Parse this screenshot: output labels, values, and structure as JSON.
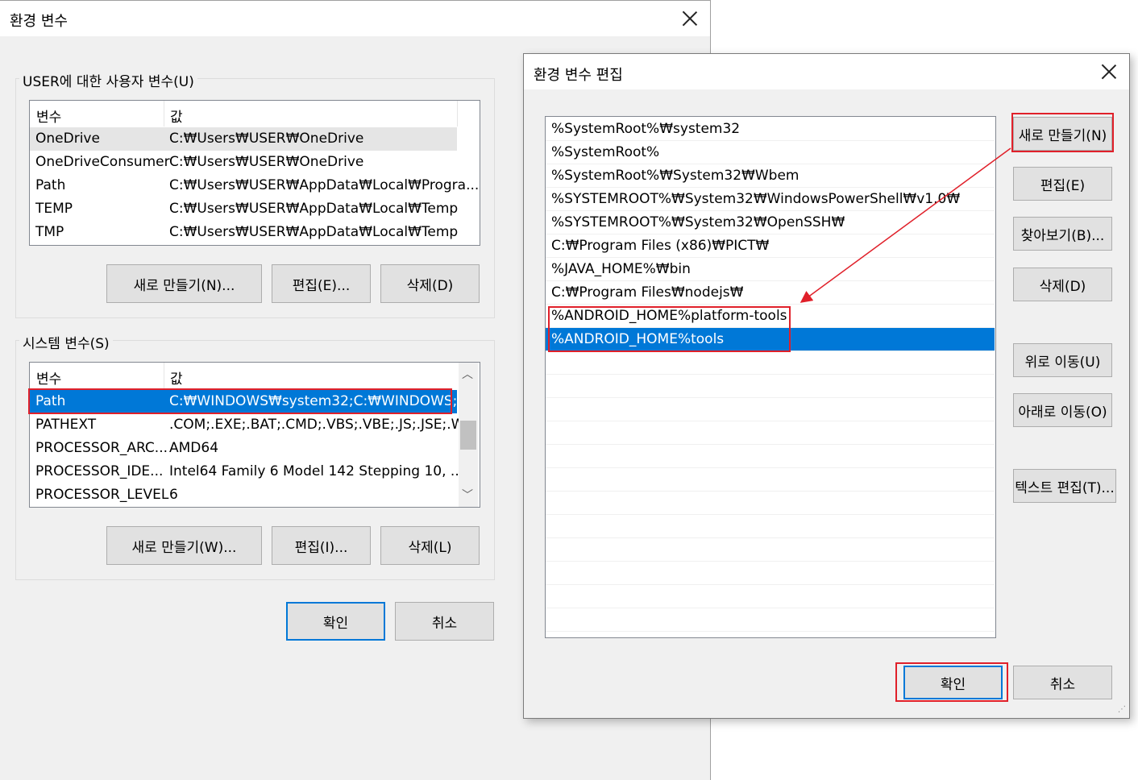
{
  "main_dialog": {
    "title": "환경 변수",
    "user_group": {
      "label": "USER에 대한 사용자 변수(U)",
      "col_var": "변수",
      "col_val": "값",
      "rows": [
        {
          "name": "OneDrive",
          "value": "C:₩Users₩USER₩OneDrive"
        },
        {
          "name": "OneDriveConsumer",
          "value": "C:₩Users₩USER₩OneDrive"
        },
        {
          "name": "Path",
          "value": "C:₩Users₩USER₩AppData₩Local₩Progra..."
        },
        {
          "name": "TEMP",
          "value": "C:₩Users₩USER₩AppData₩Local₩Temp"
        },
        {
          "name": "TMP",
          "value": "C:₩Users₩USER₩AppData₩Local₩Temp"
        }
      ],
      "btn_new": "새로 만들기(N)...",
      "btn_edit": "편집(E)...",
      "btn_delete": "삭제(D)"
    },
    "system_group": {
      "label": "시스템 변수(S)",
      "col_var": "변수",
      "col_val": "값",
      "rows": [
        {
          "name": "Path",
          "value": "C:₩WINDOWS₩system32;C:₩WINDOWS;..."
        },
        {
          "name": "PATHEXT",
          "value": ".COM;.EXE;.BAT;.CMD;.VBS;.VBE;.JS;.JSE;.W..."
        },
        {
          "name": "PROCESSOR_ARC...",
          "value": "AMD64"
        },
        {
          "name": "PROCESSOR_IDE...",
          "value": "Intel64 Family 6 Model 142 Stepping 10, ..."
        },
        {
          "name": "PROCESSOR_LEVEL",
          "value": "6"
        }
      ],
      "btn_new": "새로 만들기(W)...",
      "btn_edit": "편집(I)...",
      "btn_delete": "삭제(L)"
    },
    "btn_ok": "확인",
    "btn_cancel": "취소"
  },
  "edit_dialog": {
    "title": "환경 변수 편집",
    "entries": [
      "%SystemRoot%₩system32",
      "%SystemRoot%",
      "%SystemRoot%₩System32₩Wbem",
      "%SYSTEMROOT%₩System32₩WindowsPowerShell₩v1.0₩",
      "%SYSTEMROOT%₩System32₩OpenSSH₩",
      "C:₩Program Files (x86)₩PICT₩",
      "%JAVA_HOME%₩bin",
      "C:₩Program Files₩nodejs₩",
      "%ANDROID_HOME%platform-tools",
      "%ANDROID_HOME%tools"
    ],
    "selected_entry": "%ANDROID_HOME%tools",
    "btn_new": "새로 만들기(N)",
    "btn_edit": "편집(E)",
    "btn_browse": "찾아보기(B)...",
    "btn_delete": "삭제(D)",
    "btn_up": "위로 이동(U)",
    "btn_down": "아래로 이동(O)",
    "btn_text_edit": "텍스트 편집(T)...",
    "btn_ok": "확인",
    "btn_cancel": "취소"
  },
  "colors": {
    "selection": "#0078d7",
    "annotation": "#e0202a",
    "dialog_bg": "#f0f0f0"
  }
}
